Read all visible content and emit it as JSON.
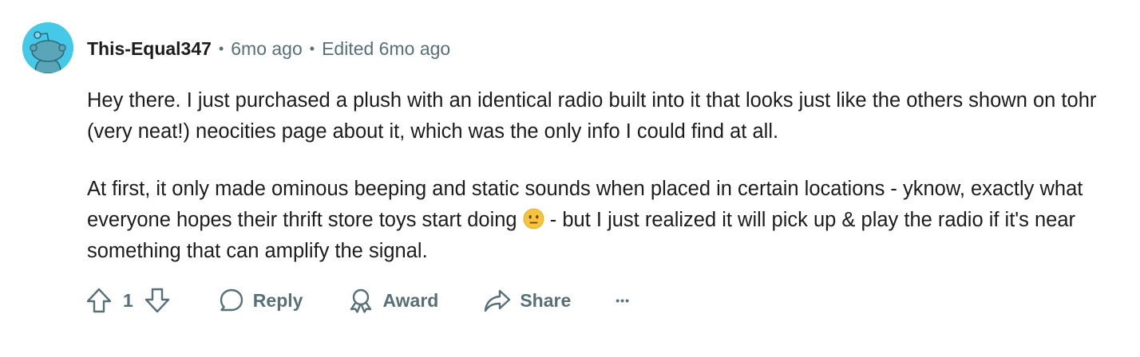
{
  "comment": {
    "username": "This-Equal347",
    "separator": "•",
    "time_ago": "6mo ago",
    "edited": "Edited 6mo ago",
    "paragraphs": {
      "p1": "Hey there. I just purchased a plush with an identical radio built into it that looks just like the others shown on tohr (very neat!) neocities page about it, which was the only info I could find at all.",
      "p2_before_emoji": "At first, it only made ominous beeping and static sounds when placed in certain locations - yknow, exactly what everyone hopes their thrift store toys start doing ",
      "p2_after_emoji": " - but I just realized it will pick up & play the radio if it's near something that can amplify the signal."
    }
  },
  "actions": {
    "vote_count": "1",
    "reply_label": "Reply",
    "award_label": "Award",
    "share_label": "Share",
    "more_label": "•••"
  },
  "icons": {
    "avatar": "reddit-snoo-avatar-icon",
    "upvote": "upvote-arrow-icon",
    "downvote": "downvote-arrow-icon",
    "reply": "speech-bubble-icon",
    "award": "award-ribbon-icon",
    "share": "share-arrow-icon",
    "emoji": "neutral-face-emoji-icon"
  },
  "colors": {
    "avatar_bg": "#46c9e8",
    "meta_text": "#576f76",
    "body_text": "#1c1c1c"
  }
}
